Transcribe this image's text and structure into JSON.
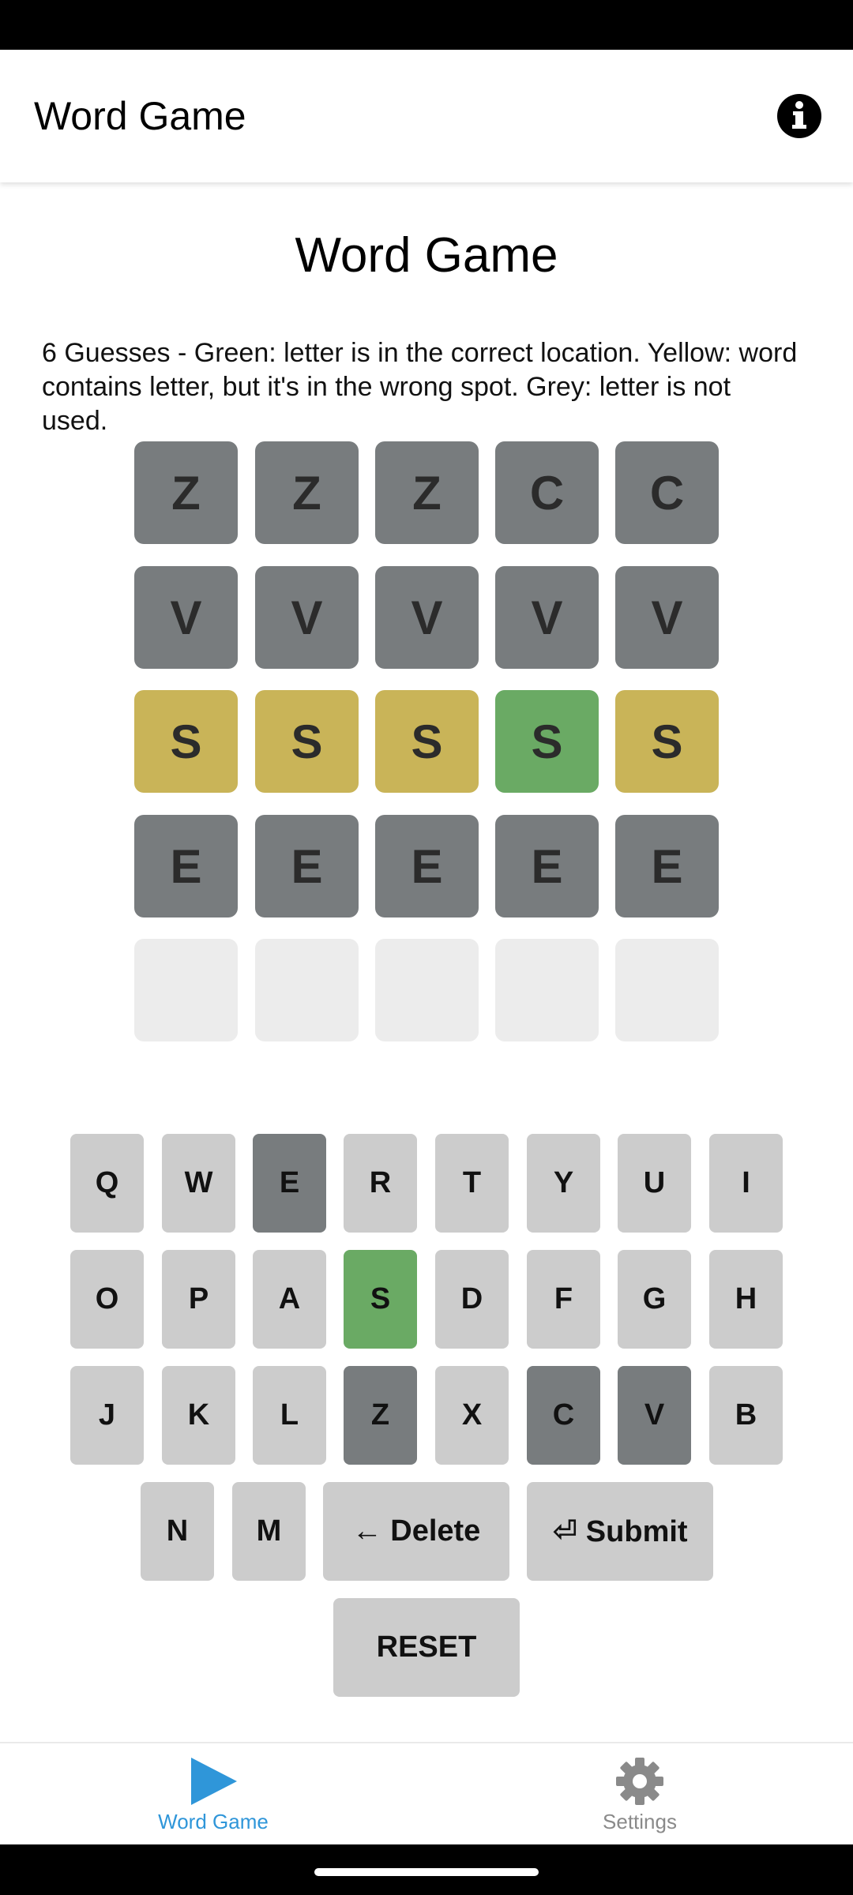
{
  "app_bar": {
    "title": "Word Game",
    "info_icon": "info-circle-icon"
  },
  "page": {
    "title": "Word Game",
    "instructions": "6 Guesses - Green: letter is in the correct location. Yellow: word contains letter, but it's in the wrong spot. Grey: letter is not used."
  },
  "colors": {
    "grey": "#787c7e",
    "yellow": "#c9b458",
    "green": "#6aaa64",
    "empty": "#ececec",
    "key": "#cccccc",
    "accent": "#2f96d9"
  },
  "board": {
    "rows": [
      {
        "letters": [
          "Z",
          "Z",
          "Z",
          "C",
          "C"
        ],
        "states": [
          "grey",
          "grey",
          "grey",
          "grey",
          "grey"
        ]
      },
      {
        "letters": [
          "V",
          "V",
          "V",
          "V",
          "V"
        ],
        "states": [
          "grey",
          "grey",
          "grey",
          "grey",
          "grey"
        ]
      },
      {
        "letters": [
          "S",
          "S",
          "S",
          "S",
          "S"
        ],
        "states": [
          "yellow",
          "yellow",
          "yellow",
          "green",
          "yellow"
        ]
      },
      {
        "letters": [
          "E",
          "E",
          "E",
          "E",
          "E"
        ],
        "states": [
          "grey",
          "grey",
          "grey",
          "grey",
          "grey"
        ]
      },
      {
        "letters": [
          "",
          "",
          "",
          "",
          ""
        ],
        "states": [
          "empty",
          "empty",
          "empty",
          "empty",
          "empty"
        ]
      }
    ]
  },
  "keyboard": {
    "row1": [
      {
        "label": "Q",
        "state": "default"
      },
      {
        "label": "W",
        "state": "default"
      },
      {
        "label": "E",
        "state": "grey"
      },
      {
        "label": "R",
        "state": "default"
      },
      {
        "label": "T",
        "state": "default"
      },
      {
        "label": "Y",
        "state": "default"
      },
      {
        "label": "U",
        "state": "default"
      },
      {
        "label": "I",
        "state": "default"
      }
    ],
    "row2": [
      {
        "label": "O",
        "state": "default"
      },
      {
        "label": "P",
        "state": "default"
      },
      {
        "label": "A",
        "state": "default"
      },
      {
        "label": "S",
        "state": "green"
      },
      {
        "label": "D",
        "state": "default"
      },
      {
        "label": "F",
        "state": "default"
      },
      {
        "label": "G",
        "state": "default"
      },
      {
        "label": "H",
        "state": "default"
      }
    ],
    "row3": [
      {
        "label": "J",
        "state": "default"
      },
      {
        "label": "K",
        "state": "default"
      },
      {
        "label": "L",
        "state": "default"
      },
      {
        "label": "Z",
        "state": "grey"
      },
      {
        "label": "X",
        "state": "default"
      },
      {
        "label": "C",
        "state": "grey"
      },
      {
        "label": "V",
        "state": "grey"
      },
      {
        "label": "B",
        "state": "default"
      }
    ],
    "row4": [
      {
        "label": "N",
        "state": "default"
      },
      {
        "label": "M",
        "state": "default"
      }
    ],
    "delete_label": "← Delete",
    "submit_label": "⏎ Submit",
    "reset_label": "RESET"
  },
  "bottom_nav": {
    "items": [
      {
        "label": "Word Game",
        "icon": "play-icon",
        "active": true
      },
      {
        "label": "Settings",
        "icon": "gear-icon",
        "active": false
      }
    ]
  }
}
